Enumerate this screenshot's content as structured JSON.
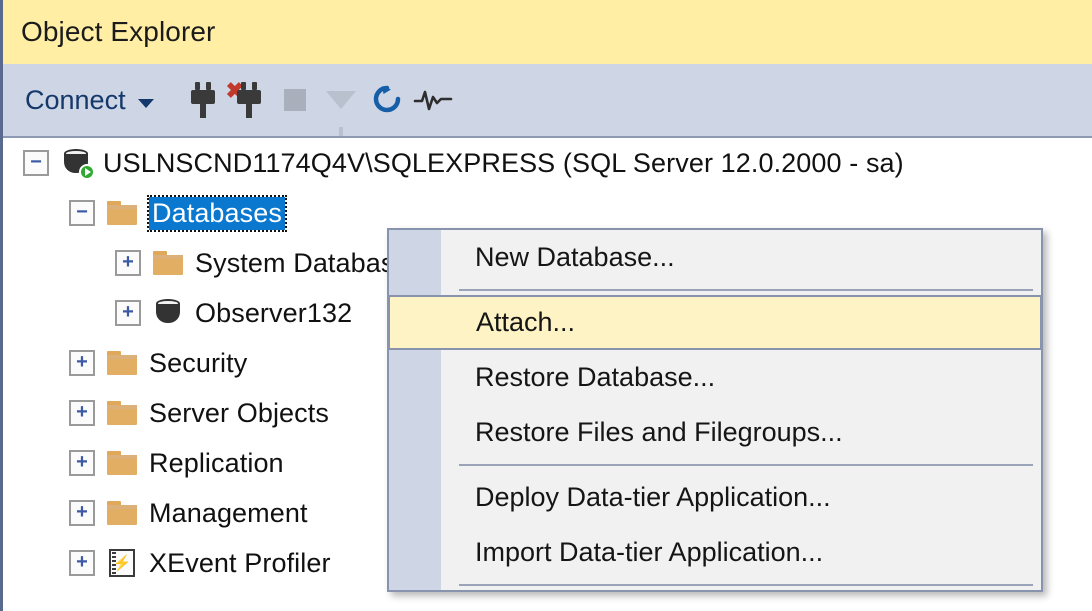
{
  "window": {
    "title": "Object Explorer"
  },
  "toolbar": {
    "connect_label": "Connect",
    "items": [
      {
        "name": "connect-icon",
        "tooltip": "Connect"
      },
      {
        "name": "disconnect-icon",
        "tooltip": "Disconnect"
      },
      {
        "name": "stop-icon",
        "tooltip": "Stop"
      },
      {
        "name": "filter-icon",
        "tooltip": "Filter"
      },
      {
        "name": "refresh-icon",
        "tooltip": "Refresh"
      },
      {
        "name": "activity-monitor-icon",
        "tooltip": "Activity Monitor"
      }
    ]
  },
  "tree": {
    "nodes": [
      {
        "label": "USLNSCND1174Q4V\\SQLEXPRESS (SQL Server 12.0.2000 - sa)",
        "indent": 0,
        "state": "expanded",
        "icon": "server-icon",
        "selected": false
      },
      {
        "label": "Databases",
        "indent": 1,
        "state": "expanded",
        "icon": "folder-icon",
        "selected": true
      },
      {
        "label": "System Databases",
        "indent": 2,
        "state": "collapsed",
        "icon": "folder-icon",
        "selected": false
      },
      {
        "label": "Observer132",
        "indent": 2,
        "state": "collapsed",
        "icon": "database-icon",
        "selected": false
      },
      {
        "label": "Security",
        "indent": 1,
        "state": "collapsed",
        "icon": "folder-icon",
        "selected": false
      },
      {
        "label": "Server Objects",
        "indent": 1,
        "state": "collapsed",
        "icon": "folder-icon",
        "selected": false
      },
      {
        "label": "Replication",
        "indent": 1,
        "state": "collapsed",
        "icon": "folder-icon",
        "selected": false
      },
      {
        "label": "Management",
        "indent": 1,
        "state": "collapsed",
        "icon": "folder-icon",
        "selected": false
      },
      {
        "label": "XEvent Profiler",
        "indent": 1,
        "state": "collapsed",
        "icon": "xevent-icon",
        "selected": false
      }
    ]
  },
  "context_menu": {
    "items": [
      {
        "type": "item",
        "label": "New Database...",
        "highlighted": false
      },
      {
        "type": "separator"
      },
      {
        "type": "item",
        "label": "Attach...",
        "highlighted": true
      },
      {
        "type": "item",
        "label": "Restore Database...",
        "highlighted": false
      },
      {
        "type": "item",
        "label": "Restore Files and Filegroups...",
        "highlighted": false
      },
      {
        "type": "separator"
      },
      {
        "type": "item",
        "label": "Deploy Data-tier Application...",
        "highlighted": false
      },
      {
        "type": "item",
        "label": "Import Data-tier Application...",
        "highlighted": false
      },
      {
        "type": "separator"
      }
    ]
  },
  "colors": {
    "titlebar": "#ffeea4",
    "toolbar": "#ced5e5",
    "selection": "#0b78d0",
    "menu_highlight": "#fdf3c5",
    "menu_background": "#f1f1f1",
    "folder": "#e2ae63",
    "accent_blue": "#15386b"
  }
}
